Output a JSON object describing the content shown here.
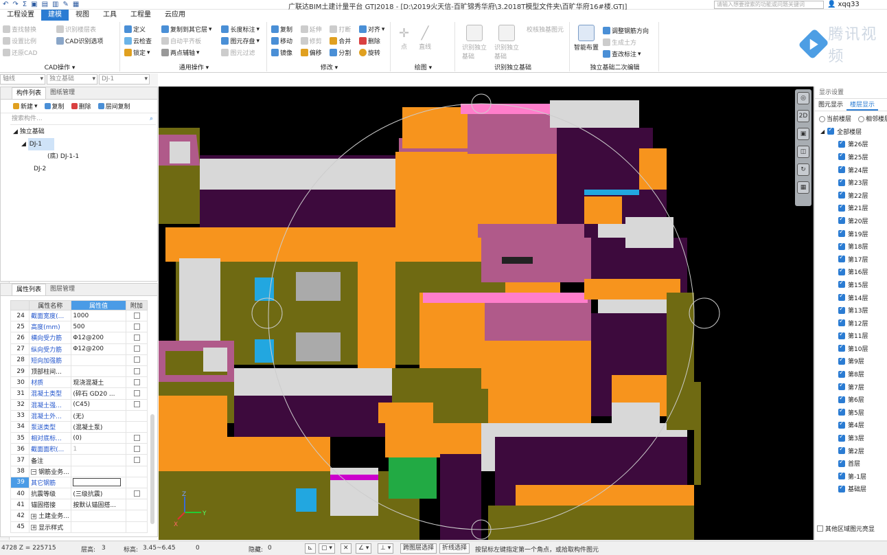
{
  "titlebar": {
    "title": "广联达BIM土建计量平台 GTJ2018 - [D:\\2019火天信-百旷锦秀华府\\3.2018T模型文件夹\\百旷华府16#楼.GTJ]",
    "search_placeholder": "请输入想要搜索的功能或问题关键词",
    "user": "xqq33"
  },
  "menu": {
    "tabs": [
      {
        "label": "工程设置"
      },
      {
        "label": "建模"
      },
      {
        "label": "视图"
      },
      {
        "label": "工具"
      },
      {
        "label": "工程量"
      },
      {
        "label": "云应用"
      }
    ]
  },
  "ribbon": {
    "cad": {
      "name": "CAD操作",
      "items": [
        "查找替换",
        "识别楼层表",
        "设置比例",
        "CAD识别选项",
        "还原CAD"
      ]
    },
    "general": {
      "name": "通用操作",
      "items": [
        "定义",
        "复制到其它层",
        "长度标注",
        "云检查",
        "自动平齐板",
        "图元存盘",
        "锁定",
        "两点辅轴",
        "图元过滤"
      ]
    },
    "modify": {
      "name": "修改",
      "items": [
        "复制",
        "延伸",
        "打断",
        "对齐",
        "移动",
        "修剪",
        "合并",
        "删除",
        "镜像",
        "偏移",
        "分割",
        "旋转"
      ]
    },
    "draw": {
      "name": "绘图",
      "items": [
        "点",
        "直线"
      ]
    },
    "identify": {
      "name": "识别独立基础",
      "items": [
        "识别独立基础",
        "识别独立基础",
        "校核独基图元"
      ]
    },
    "secondary": {
      "name": "独立基础二次编辑",
      "items": [
        "智能布置",
        "调整钢筋方向",
        "生成土方",
        "查改标注"
      ]
    }
  },
  "logo": {
    "text": "腾讯视频"
  },
  "selectors": [
    "轴线",
    "独立基础",
    "DJ-1"
  ],
  "component_panel": {
    "tabs": [
      "构件列表",
      "图纸管理"
    ],
    "tools": [
      "新建",
      "复制",
      "删除",
      "层间复制"
    ],
    "search_placeholder": "搜索构件...",
    "tree": [
      {
        "label": "独立基础",
        "level": 0
      },
      {
        "label": "DJ-1",
        "level": 1,
        "selected": true
      },
      {
        "label": "(底) DJ-1-1",
        "level": 2
      },
      {
        "label": "DJ-2",
        "level": 1
      }
    ]
  },
  "property_panel": {
    "tabs": [
      "属性列表",
      "图层管理"
    ],
    "headers": [
      "属性名称",
      "属性值",
      "附加"
    ],
    "rows": [
      {
        "num": "24",
        "name": "截面宽度(...",
        "value": "1000",
        "blue": true,
        "check": true
      },
      {
        "num": "25",
        "name": "高度(mm)",
        "value": "500",
        "blue": true,
        "check": true
      },
      {
        "num": "26",
        "name": "横向受力筋",
        "value": "Φ12@200",
        "blue": true,
        "check": true
      },
      {
        "num": "27",
        "name": "纵向受力筋",
        "value": "Φ12@200",
        "blue": true,
        "check": true
      },
      {
        "num": "28",
        "name": "短向加强筋",
        "value": "",
        "blue": true,
        "check": true
      },
      {
        "num": "29",
        "name": "顶部柱间...",
        "value": "",
        "blue": false,
        "check": true
      },
      {
        "num": "30",
        "name": "材质",
        "value": "现浇混凝土",
        "blue": true,
        "check": true
      },
      {
        "num": "31",
        "name": "混凝土类型",
        "value": "(碎石 GD20 ...",
        "blue": true,
        "check": true
      },
      {
        "num": "32",
        "name": "混凝土强...",
        "value": "(C45)",
        "blue": true,
        "check": true
      },
      {
        "num": "33",
        "name": "混凝土外...",
        "value": "(无)",
        "blue": true,
        "check": false
      },
      {
        "num": "34",
        "name": "泵送类型",
        "value": "(混凝土泵)",
        "blue": true,
        "check": false
      },
      {
        "num": "35",
        "name": "相对底标...",
        "value": "(0)",
        "blue": true,
        "check": true
      },
      {
        "num": "36",
        "name": "截面面积(...",
        "value": "1",
        "blue": true,
        "check": true,
        "dim": true
      },
      {
        "num": "37",
        "name": "备注",
        "value": "",
        "blue": false,
        "check": true
      },
      {
        "num": "38",
        "name": "钢筋业务...",
        "value": "",
        "blue": false,
        "check": false,
        "expand": "−"
      },
      {
        "num": "39",
        "name": "其它钢筋",
        "value": "",
        "blue": true,
        "check": false,
        "current": true
      },
      {
        "num": "40",
        "name": "抗震等级",
        "value": "(三级抗震)",
        "blue": false,
        "check": true
      },
      {
        "num": "41",
        "name": "锚固搭接",
        "value": "按默认锚固搭...",
        "blue": false,
        "check": false
      },
      {
        "num": "42",
        "name": "土建业务...",
        "value": "",
        "blue": false,
        "check": false,
        "expand": "+"
      },
      {
        "num": "45",
        "name": "显示样式",
        "value": "",
        "blue": false,
        "check": false,
        "expand": "+"
      }
    ]
  },
  "display_panel": {
    "header": "显示设置",
    "tabs": [
      "图元显示",
      "楼层显示"
    ],
    "radios": [
      "当前楼层",
      "相邻楼层"
    ],
    "floors": [
      "全部楼层",
      "第26层",
      "第25层",
      "第24层",
      "第23层",
      "第22层",
      "第21层",
      "第20层",
      "第19层",
      "第18层",
      "第17层",
      "第16层",
      "第15层",
      "第14层",
      "第13层",
      "第12层",
      "第11层",
      "第10层",
      "第9层",
      "第8层",
      "第7层",
      "第6层",
      "第5层",
      "第4层",
      "第3层",
      "第2层",
      "首层",
      "第-1层",
      "基础层"
    ],
    "bottom_option": "其他区域图元亮显"
  },
  "viewport": {
    "colors": {
      "orange": "#f7941d",
      "purple": "#3d0a3d",
      "olive": "#6f6a12",
      "gray": "#d8d8d8",
      "pink": "#b05a8a",
      "blue": "#22a7e0",
      "black": "#000000"
    },
    "axis": {
      "x": "X",
      "y": "Y",
      "z": "Z"
    }
  },
  "statusbar": {
    "coords": "4728 Z = 225715",
    "floor_label": "层高:",
    "floor_value": "3",
    "elev_label": "标高:",
    "elev_value": "3.45~6.45",
    "zero": "0",
    "hidden_label": "隐藏:",
    "hidden_value": "0",
    "btn_cross": "跨图层选择",
    "btn_poly": "折线选择",
    "hint": "按鼠标左键指定第一个角点，或拾取构件图元"
  }
}
